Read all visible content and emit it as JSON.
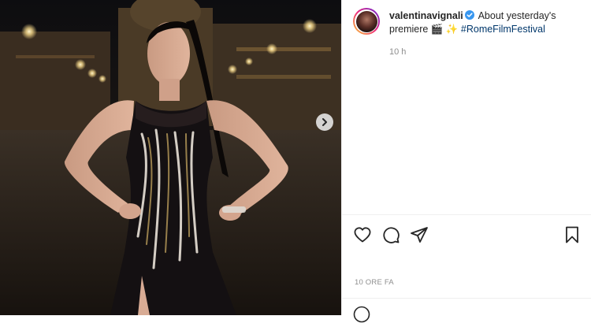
{
  "post": {
    "username": "valentinavignali",
    "caption_text": "About yesterday's premiere 🎬 ✨",
    "hashtag": "#RomeFilmFestival",
    "caption_time": "10 h",
    "posted_time": "10 ORE FA"
  },
  "icons": {
    "verified": "verified-badge-icon",
    "like": "heart-icon",
    "comment": "comment-bubble-icon",
    "share": "paper-plane-icon",
    "save": "bookmark-icon",
    "next": "chevron-right-icon",
    "emoji": "smiley-icon"
  },
  "colors": {
    "verified_blue": "#3897f0",
    "hashtag_blue": "#00376b",
    "muted_text": "#8e8e8e"
  }
}
